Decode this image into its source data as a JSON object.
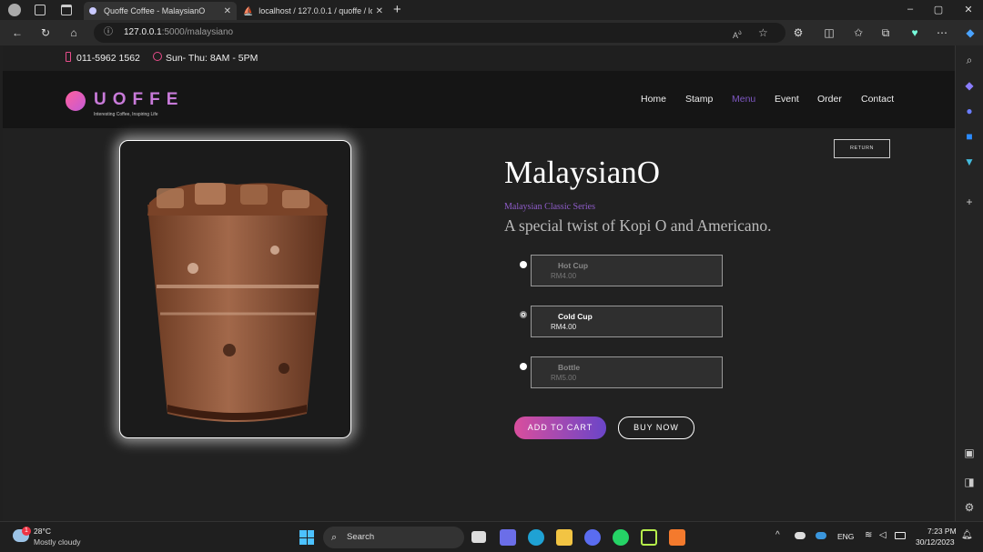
{
  "browser": {
    "tabs": [
      {
        "label": "Quoffe Coffee - MalaysianO",
        "active": true
      },
      {
        "label": "localhost / 127.0.0.1 / quoffe / lo",
        "active": false
      }
    ],
    "url_host": "127.0.0.1",
    "url_path": ":5000/malaysiano"
  },
  "topinfo": {
    "phone": "011-5962 1562",
    "hours": "Sun- Thu: 8AM - 5PM"
  },
  "header": {
    "logo": "UOFFE",
    "tagline": "Interesting Coffee, Inspiring Life",
    "nav": [
      "Home",
      "Stamp",
      "Menu",
      "Event",
      "Order",
      "Contact"
    ],
    "active_nav": "Menu"
  },
  "product": {
    "return_label": "RETURN",
    "title": "MalaysianO",
    "series": "Malaysian Classic Series",
    "description": "A special twist of Kopi O and Americano.",
    "options": [
      {
        "name": "Hot Cup",
        "price": "RM4.00",
        "selected": false
      },
      {
        "name": "Cold Cup",
        "price": "RM4.00",
        "selected": true
      },
      {
        "name": "Bottle",
        "price": "RM5.00",
        "selected": false
      }
    ],
    "add_to_cart": "ADD TO CART",
    "buy_now": "BUY NOW"
  },
  "taskbar": {
    "weather_temp": "28°C",
    "weather_desc": "Mostly cloudy",
    "search": "Search",
    "lang": "ENG",
    "time": "7:23 PM",
    "date": "30/12/2023"
  },
  "colors": {
    "accent": "#7e57c2",
    "brand_pink": "#ff5f9e",
    "cart_gradient_start": "#d94e9d",
    "cart_gradient_end": "#6a45c8"
  }
}
